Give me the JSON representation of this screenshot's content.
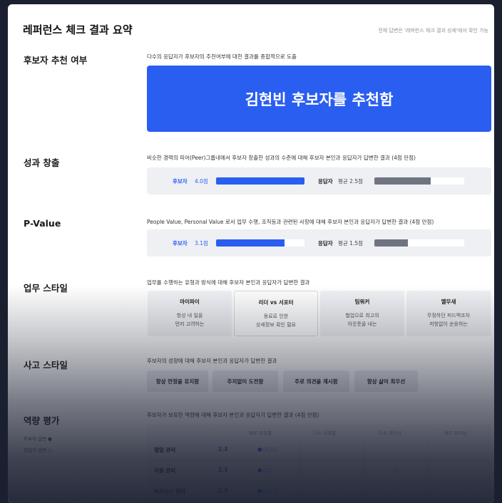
{
  "header": {
    "title": "레퍼런스 체크 결과 요약",
    "hint": "전체 답변은 '레퍼런스 체크 결과 상세'에서 확인 가능"
  },
  "recommendation": {
    "label": "후보자 추천 여부",
    "description": "다수의 응답자가 후보자의 추천여부에 대한 결과를 종합적으로 도출",
    "result": "김현빈 후보자를 추천함"
  },
  "performance": {
    "label": "성과 창출",
    "description": "비슷한 경력의 피어(Peer)그룹내에서 후보자 창출한 성과의 수준에 대해 후보자 본인과 응답자가 답변한 결과 (4점 만점)",
    "candidate_label": "후보자",
    "candidate_value": "4.0점",
    "candidate_fraction": 1.0,
    "respondent_label": "응답자",
    "respondent_value": "평균 2.5점",
    "respondent_fraction": 0.625
  },
  "pvalue": {
    "label": "P-Value",
    "description": "People Value, Personal Value 로서 업무 수행, 조직등과 관련된 사항에 대해 후보자 본인과 응답자가 답변한 결과 (4점 만점)",
    "candidate_label": "후보자",
    "candidate_value": "3.1점",
    "candidate_fraction": 0.775,
    "respondent_label": "응답자",
    "respondent_value": "평균 1.5점",
    "respondent_fraction": 0.375
  },
  "work_style": {
    "label": "업무 스타일",
    "description": "업무를 수행하는 유형과 방식에 대해 후보자 본인과 응답자가 답변한 결과",
    "cards": [
      {
        "title": "마이파이",
        "line1": "항상 내 일을",
        "line2": "먼저 고려하는"
      },
      {
        "title": "리더 vs 서포터",
        "line1": "동료로 인한",
        "line2": "상세정보 확인 필요"
      },
      {
        "title": "팀워커",
        "line1": "협업으로 최고의",
        "line2": "아웃풋을 내는"
      },
      {
        "title": "옐무새",
        "line1": "무정하던 피드백조차",
        "line2": "저항없이 순응하는"
      }
    ]
  },
  "thinking_style": {
    "label": "사고 스타일",
    "description": "후보자의 성향에 대해 후보자 본인과 응답자가 답변한 결과",
    "chips": [
      "항상 안정을 유지함",
      "주저없이 도전함",
      "주로 의견을 제시함",
      "항상 삶이 최우선"
    ]
  },
  "competency": {
    "label": "역량 평가",
    "legend_candidate": "후보자 답변 ●",
    "legend_respondent": "응답자 답변 ○",
    "description": "후보자가 보유한 역량에 대해 후보자 본인과 응답자가 답변한 결과 (4점 만점)",
    "columns": [
      "매우 부족함",
      "다소 부족함",
      "다소 뛰어남",
      "매우 뛰어남"
    ],
    "rows": [
      {
        "name": "협업 관리",
        "score": "2.3",
        "dots": "●○○○"
      },
      {
        "name": "자원 관리",
        "score": "2.3",
        "dots": "●○○",
        "extra": "○"
      },
      {
        "name": "비즈니스 관리",
        "score": "2.3",
        "dots": "●○○○"
      }
    ]
  },
  "colors": {
    "accent": "#2a5ef0",
    "respondent_bar": "#6f7480",
    "background": "#1b2031"
  }
}
